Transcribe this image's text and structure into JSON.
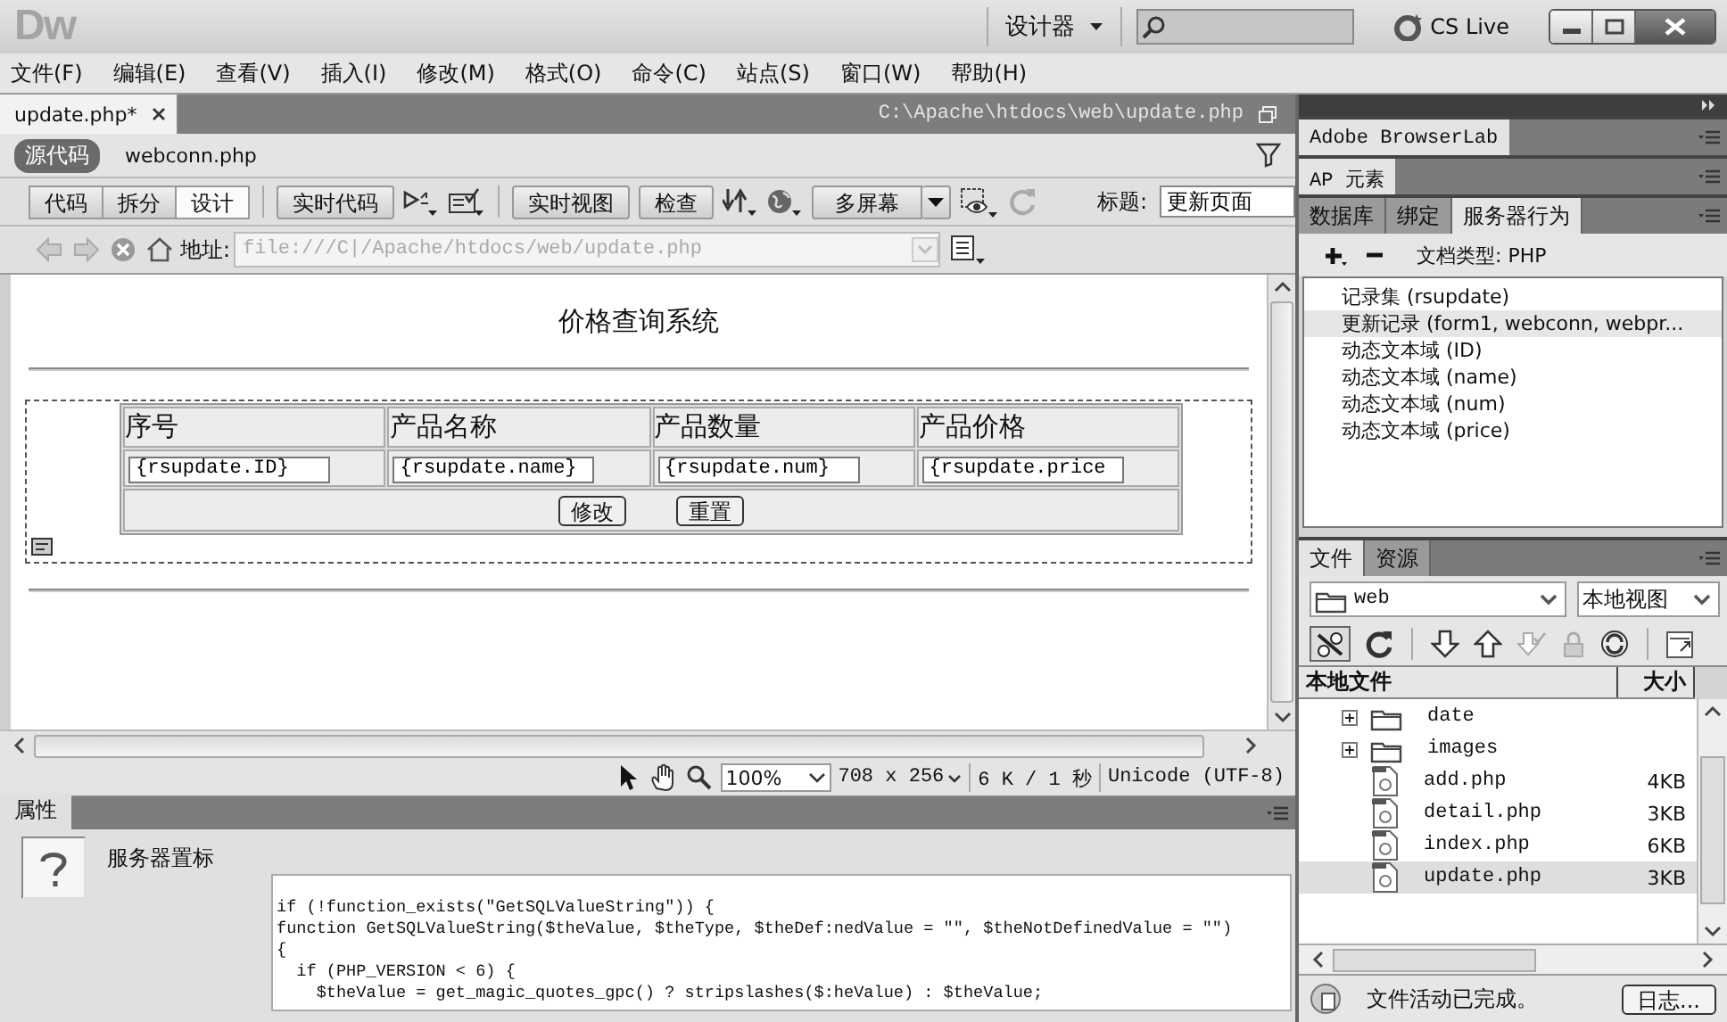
{
  "app_bar": {
    "logo": "Dw",
    "workspace": "设计器",
    "cs_live": "CS Live"
  },
  "menu": [
    "文件(F)",
    "编辑(E)",
    "查看(V)",
    "插入(I)",
    "修改(M)",
    "格式(O)",
    "命令(C)",
    "站点(S)",
    "窗口(W)",
    "帮助(H)"
  ],
  "document": {
    "tab": {
      "label": "update.php*",
      "path": "C:\\Apache\\htdocs\\web\\update.php"
    },
    "related_files": [
      {
        "label": "源代码",
        "selected": true
      },
      {
        "label": "webconn.php",
        "selected": false
      }
    ],
    "views": [
      {
        "label": "代码",
        "selected": false
      },
      {
        "label": "拆分",
        "selected": false
      },
      {
        "label": "设计",
        "selected": true
      }
    ],
    "live_code": "实时代码",
    "live_view": "实时视图",
    "inspect": "检查",
    "multiscreen": "多屏幕",
    "title_label": "标题:",
    "title_value": "更新页面",
    "address_label": "地址:",
    "address_value": "file:///C|/Apache/htdocs/web/update.php"
  },
  "page": {
    "heading": "价格查询系统",
    "columns": [
      "序号",
      "产品名称",
      "产品数量",
      "产品价格"
    ],
    "fields": [
      "{rsupdate.ID}",
      "{rsupdate.name}",
      "{rsupdate.num}",
      "{rsupdate.price"
    ],
    "buttons": [
      "修改",
      "重置"
    ]
  },
  "status_bar": {
    "zoom": "100%",
    "size": "708 x 256",
    "download": "6 K / 1 秒",
    "encoding": "Unicode (UTF-8)"
  },
  "properties": {
    "tab": "属性",
    "label": "服务器置标",
    "code": [
      "if (!function_exists(\"GetSQLValueString\")) {",
      "function GetSQLValueString($theValue, $theType, $theDef:nedValue = \"\", $theNotDefinedValue = \"\")",
      "{",
      "  if (PHP_VERSION < 6) {",
      "    $theValue = get_magic_quotes_gpc() ? stripslashes($:heValue) : $theValue;"
    ]
  },
  "panels": {
    "browserlab": "Adobe BrowserLab",
    "ap": "AP 元素",
    "server_tabs": [
      {
        "label": "数据库",
        "selected": false
      },
      {
        "label": "绑定",
        "selected": false
      },
      {
        "label": "服务器行为",
        "selected": true
      }
    ],
    "doc_type": "文档类型: PHP",
    "behaviors": [
      {
        "text": "记录集 (rsupdate)",
        "selected": false
      },
      {
        "text": "更新记录 (form1, webconn, webpr...",
        "selected": true
      },
      {
        "text": "动态文本域 (ID)",
        "selected": false
      },
      {
        "text": "动态文本域 (name)",
        "selected": false
      },
      {
        "text": "动态文本域 (num)",
        "selected": false
      },
      {
        "text": "动态文本域 (price)",
        "selected": false
      }
    ]
  },
  "files": {
    "tabs": [
      {
        "label": "文件",
        "selected": true
      },
      {
        "label": "资源",
        "selected": false
      }
    ],
    "site": "web",
    "view": "本地视图",
    "columns": [
      "本地文件",
      "大小"
    ],
    "items": [
      {
        "name": "date",
        "kind": "folder",
        "expanded": false,
        "selected": false
      },
      {
        "name": "images",
        "kind": "folder",
        "expanded": false,
        "selected": false
      },
      {
        "name": "add.php",
        "kind": "file",
        "size": "4KB",
        "selected": false
      },
      {
        "name": "detail.php",
        "kind": "file",
        "size": "3KB",
        "selected": false
      },
      {
        "name": "index.php",
        "kind": "file",
        "size": "6KB",
        "selected": false
      },
      {
        "name": "update.php",
        "kind": "file",
        "size": "3KB",
        "selected": true
      }
    ],
    "status": "文件活动已完成。",
    "log_button": "日志..."
  }
}
